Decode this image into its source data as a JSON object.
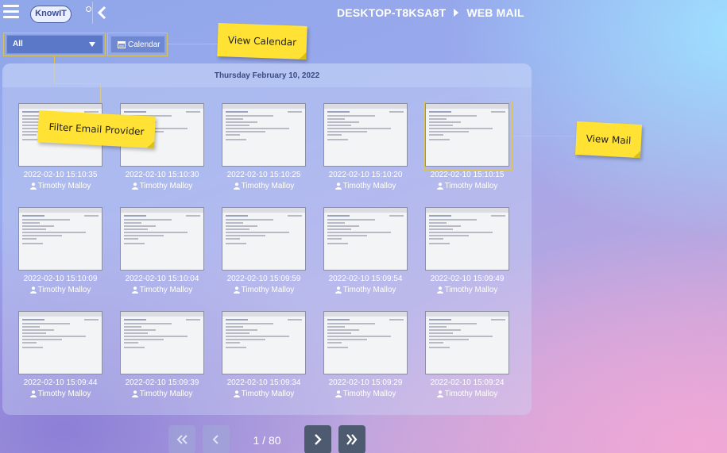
{
  "header": {
    "logo_text": "KnowIT",
    "breadcrumb": [
      "DESKTOP-T8KSA8T",
      "WEB MAIL"
    ]
  },
  "toolbar": {
    "filter_value": "All",
    "calendar_label": "Calendar"
  },
  "callouts": {
    "view_calendar": "View Calendar",
    "filter_email_provider": "Filter Email Provider",
    "view_mail": "View Mail"
  },
  "panel": {
    "date_heading": "Thursday February 10, 2022"
  },
  "tiles": [
    {
      "time": "2022-02-10 15:10:35",
      "user": "Timothy Malloy"
    },
    {
      "time": "2022-02-10 15:10:30",
      "user": "Timothy Malloy"
    },
    {
      "time": "2022-02-10 15:10:25",
      "user": "Timothy Malloy"
    },
    {
      "time": "2022-02-10 15:10:20",
      "user": "Timothy Malloy"
    },
    {
      "time": "2022-02-10 15:10:15",
      "user": "Timothy Malloy"
    },
    {
      "time": "2022-02-10 15:10:09",
      "user": "Timothy Malloy"
    },
    {
      "time": "2022-02-10 15:10:04",
      "user": "Timothy Malloy"
    },
    {
      "time": "2022-02-10 15:09:59",
      "user": "Timothy Malloy"
    },
    {
      "time": "2022-02-10 15:09:54",
      "user": "Timothy Malloy"
    },
    {
      "time": "2022-02-10 15:09:49",
      "user": "Timothy Malloy"
    },
    {
      "time": "2022-02-10 15:09:44",
      "user": "Timothy Malloy"
    },
    {
      "time": "2022-02-10 15:09:39",
      "user": "Timothy Malloy"
    },
    {
      "time": "2022-02-10 15:09:34",
      "user": "Timothy Malloy"
    },
    {
      "time": "2022-02-10 15:09:29",
      "user": "Timothy Malloy"
    },
    {
      "time": "2022-02-10 15:09:24",
      "user": "Timothy Malloy"
    }
  ],
  "pagination": {
    "label": "1 / 80"
  },
  "colors": {
    "callout": "#ffe234",
    "pager_active": "#4d5a70",
    "filter_bg": "#5b78c8"
  }
}
